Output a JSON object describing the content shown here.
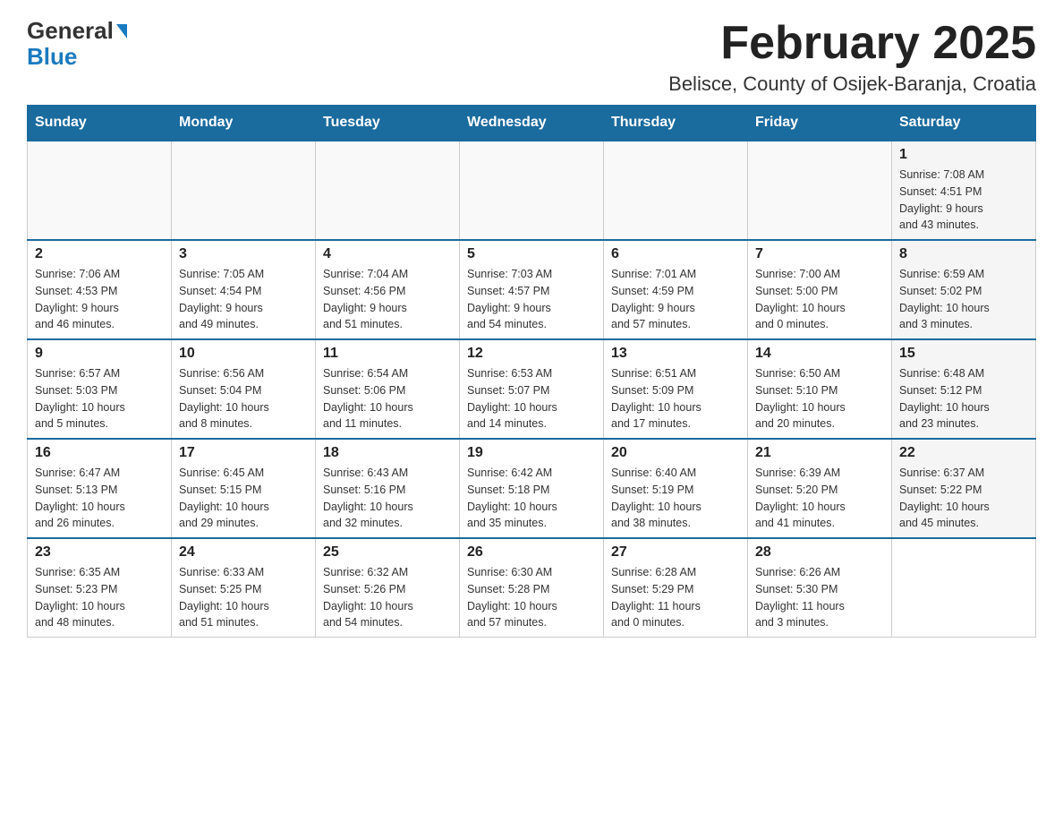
{
  "logo": {
    "line1": "General",
    "triangle": "▶",
    "line2": "Blue"
  },
  "title": "February 2025",
  "subtitle": "Belisce, County of Osijek-Baranja, Croatia",
  "weekdays": [
    "Sunday",
    "Monday",
    "Tuesday",
    "Wednesday",
    "Thursday",
    "Friday",
    "Saturday"
  ],
  "weeks": [
    [
      {
        "day": "",
        "info": ""
      },
      {
        "day": "",
        "info": ""
      },
      {
        "day": "",
        "info": ""
      },
      {
        "day": "",
        "info": ""
      },
      {
        "day": "",
        "info": ""
      },
      {
        "day": "",
        "info": ""
      },
      {
        "day": "1",
        "info": "Sunrise: 7:08 AM\nSunset: 4:51 PM\nDaylight: 9 hours\nand 43 minutes."
      }
    ],
    [
      {
        "day": "2",
        "info": "Sunrise: 7:06 AM\nSunset: 4:53 PM\nDaylight: 9 hours\nand 46 minutes."
      },
      {
        "day": "3",
        "info": "Sunrise: 7:05 AM\nSunset: 4:54 PM\nDaylight: 9 hours\nand 49 minutes."
      },
      {
        "day": "4",
        "info": "Sunrise: 7:04 AM\nSunset: 4:56 PM\nDaylight: 9 hours\nand 51 minutes."
      },
      {
        "day": "5",
        "info": "Sunrise: 7:03 AM\nSunset: 4:57 PM\nDaylight: 9 hours\nand 54 minutes."
      },
      {
        "day": "6",
        "info": "Sunrise: 7:01 AM\nSunset: 4:59 PM\nDaylight: 9 hours\nand 57 minutes."
      },
      {
        "day": "7",
        "info": "Sunrise: 7:00 AM\nSunset: 5:00 PM\nDaylight: 10 hours\nand 0 minutes."
      },
      {
        "day": "8",
        "info": "Sunrise: 6:59 AM\nSunset: 5:02 PM\nDaylight: 10 hours\nand 3 minutes."
      }
    ],
    [
      {
        "day": "9",
        "info": "Sunrise: 6:57 AM\nSunset: 5:03 PM\nDaylight: 10 hours\nand 5 minutes."
      },
      {
        "day": "10",
        "info": "Sunrise: 6:56 AM\nSunset: 5:04 PM\nDaylight: 10 hours\nand 8 minutes."
      },
      {
        "day": "11",
        "info": "Sunrise: 6:54 AM\nSunset: 5:06 PM\nDaylight: 10 hours\nand 11 minutes."
      },
      {
        "day": "12",
        "info": "Sunrise: 6:53 AM\nSunset: 5:07 PM\nDaylight: 10 hours\nand 14 minutes."
      },
      {
        "day": "13",
        "info": "Sunrise: 6:51 AM\nSunset: 5:09 PM\nDaylight: 10 hours\nand 17 minutes."
      },
      {
        "day": "14",
        "info": "Sunrise: 6:50 AM\nSunset: 5:10 PM\nDaylight: 10 hours\nand 20 minutes."
      },
      {
        "day": "15",
        "info": "Sunrise: 6:48 AM\nSunset: 5:12 PM\nDaylight: 10 hours\nand 23 minutes."
      }
    ],
    [
      {
        "day": "16",
        "info": "Sunrise: 6:47 AM\nSunset: 5:13 PM\nDaylight: 10 hours\nand 26 minutes."
      },
      {
        "day": "17",
        "info": "Sunrise: 6:45 AM\nSunset: 5:15 PM\nDaylight: 10 hours\nand 29 minutes."
      },
      {
        "day": "18",
        "info": "Sunrise: 6:43 AM\nSunset: 5:16 PM\nDaylight: 10 hours\nand 32 minutes."
      },
      {
        "day": "19",
        "info": "Sunrise: 6:42 AM\nSunset: 5:18 PM\nDaylight: 10 hours\nand 35 minutes."
      },
      {
        "day": "20",
        "info": "Sunrise: 6:40 AM\nSunset: 5:19 PM\nDaylight: 10 hours\nand 38 minutes."
      },
      {
        "day": "21",
        "info": "Sunrise: 6:39 AM\nSunset: 5:20 PM\nDaylight: 10 hours\nand 41 minutes."
      },
      {
        "day": "22",
        "info": "Sunrise: 6:37 AM\nSunset: 5:22 PM\nDaylight: 10 hours\nand 45 minutes."
      }
    ],
    [
      {
        "day": "23",
        "info": "Sunrise: 6:35 AM\nSunset: 5:23 PM\nDaylight: 10 hours\nand 48 minutes."
      },
      {
        "day": "24",
        "info": "Sunrise: 6:33 AM\nSunset: 5:25 PM\nDaylight: 10 hours\nand 51 minutes."
      },
      {
        "day": "25",
        "info": "Sunrise: 6:32 AM\nSunset: 5:26 PM\nDaylight: 10 hours\nand 54 minutes."
      },
      {
        "day": "26",
        "info": "Sunrise: 6:30 AM\nSunset: 5:28 PM\nDaylight: 10 hours\nand 57 minutes."
      },
      {
        "day": "27",
        "info": "Sunrise: 6:28 AM\nSunset: 5:29 PM\nDaylight: 11 hours\nand 0 minutes."
      },
      {
        "day": "28",
        "info": "Sunrise: 6:26 AM\nSunset: 5:30 PM\nDaylight: 11 hours\nand 3 minutes."
      },
      {
        "day": "",
        "info": ""
      }
    ]
  ]
}
